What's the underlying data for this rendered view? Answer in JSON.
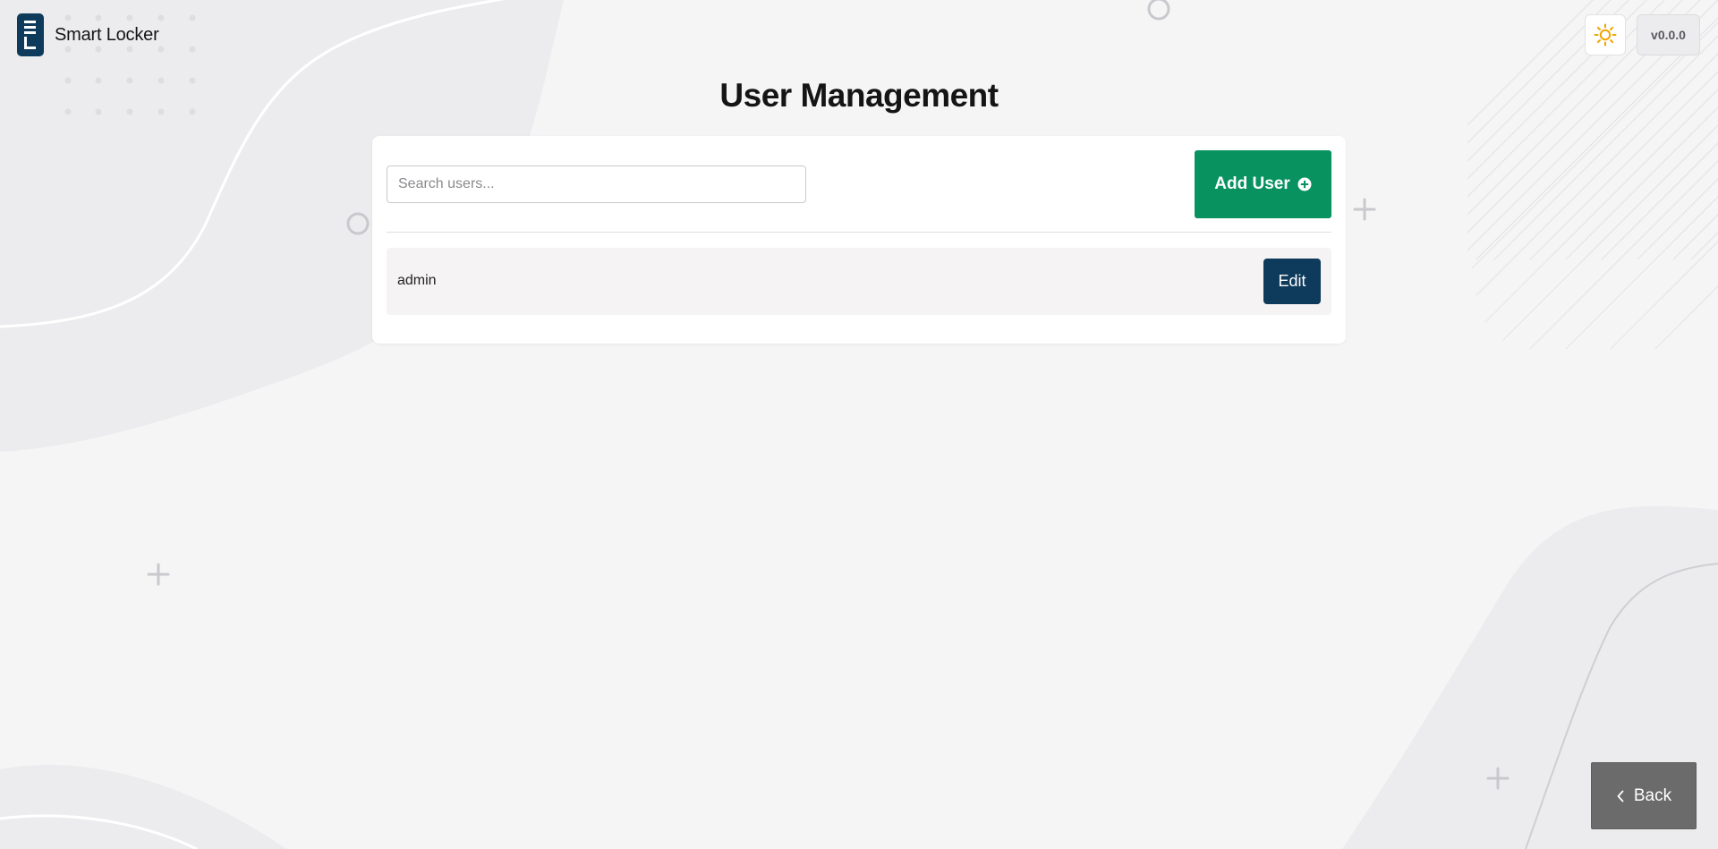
{
  "app": {
    "name": "Smart Locker",
    "logo_icon": "locker-logo-icon"
  },
  "header": {
    "theme_toggle_icon": "sun-icon",
    "version": "v0.0.0"
  },
  "page": {
    "title": "User Management"
  },
  "toolbar": {
    "search_placeholder": "Search users...",
    "search_value": "",
    "add_user_label": "Add User",
    "add_user_icon": "plus-circle-icon"
  },
  "users": [
    {
      "name": "admin",
      "edit_label": "Edit"
    }
  ],
  "footer": {
    "back_label": "Back",
    "back_icon": "chevron-left-icon"
  },
  "colors": {
    "primary": "#0e3a5b",
    "success": "#07925f",
    "secondary": "#6b6b6b",
    "sun": "#f0a500",
    "background": "#f5f5f6"
  }
}
